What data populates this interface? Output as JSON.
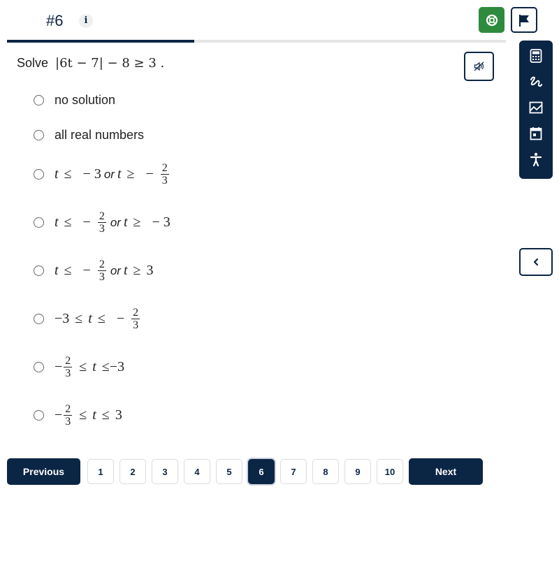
{
  "header": {
    "question_number": "#6",
    "info_label": "i",
    "progress_fraction": 0.375
  },
  "tools": {
    "help": "help-lifebuoy-icon",
    "flag": "flag-icon",
    "sidebar": [
      "calculator-icon",
      "scratchpad-icon",
      "graph-icon",
      "calendar-icon",
      "accessibility-icon"
    ],
    "mute": "muted-speaker-icon",
    "collapse": "chevron-left-icon"
  },
  "question": {
    "lead": "Solve",
    "expression": "|6t − 7| − 8 ≥ 3 ."
  },
  "choices": [
    {
      "id": "a",
      "text": "no solution"
    },
    {
      "id": "b",
      "text": "all real numbers"
    },
    {
      "id": "c",
      "text": "t ≤ −3 or t ≥ −2/3",
      "parts": {
        "l1": "t",
        "op1": "≤",
        "v1": "− 3",
        "or": "or",
        "l2": "t",
        "op2": "≥",
        "neg": "−",
        "num": "2",
        "den": "3"
      }
    },
    {
      "id": "d",
      "text": "t ≤ −2/3 or t ≥ −3",
      "parts": {
        "l1": "t",
        "op1": "≤",
        "neg": "−",
        "num": "2",
        "den": "3",
        "or": "or",
        "l2": "t",
        "op2": "≥",
        "v2": "− 3"
      }
    },
    {
      "id": "e",
      "text": "t ≤ −2/3 or t ≥ 3",
      "parts": {
        "l1": "t",
        "op1": "≤",
        "neg": "−",
        "num": "2",
        "den": "3",
        "or": "or",
        "l2": "t",
        "op2": "≥",
        "v2": "3"
      }
    },
    {
      "id": "f",
      "text": "−3 ≤ t ≤ −2/3",
      "parts": {
        "v1": "−3",
        "op1": "≤",
        "l": "t",
        "op2": "≤",
        "neg": "−",
        "num": "2",
        "den": "3"
      }
    },
    {
      "id": "g",
      "text": "−2/3 ≤ t ≤ −3",
      "parts": {
        "neg": "−",
        "num": "2",
        "den": "3",
        "op1": "≤",
        "l": "t",
        "op2": "≤",
        "v2": "−3"
      }
    },
    {
      "id": "h",
      "text": "−2/3 ≤ t ≤ 3",
      "parts": {
        "neg": "−",
        "num": "2",
        "den": "3",
        "op1": "≤",
        "l": "t",
        "op2": "≤",
        "v2": "3"
      }
    }
  ],
  "pager": {
    "previous_label": "Previous",
    "next_label": "Next",
    "pages": [
      "1",
      "2",
      "3",
      "4",
      "5",
      "6",
      "7",
      "8",
      "9",
      "10"
    ],
    "current_page": "6"
  }
}
